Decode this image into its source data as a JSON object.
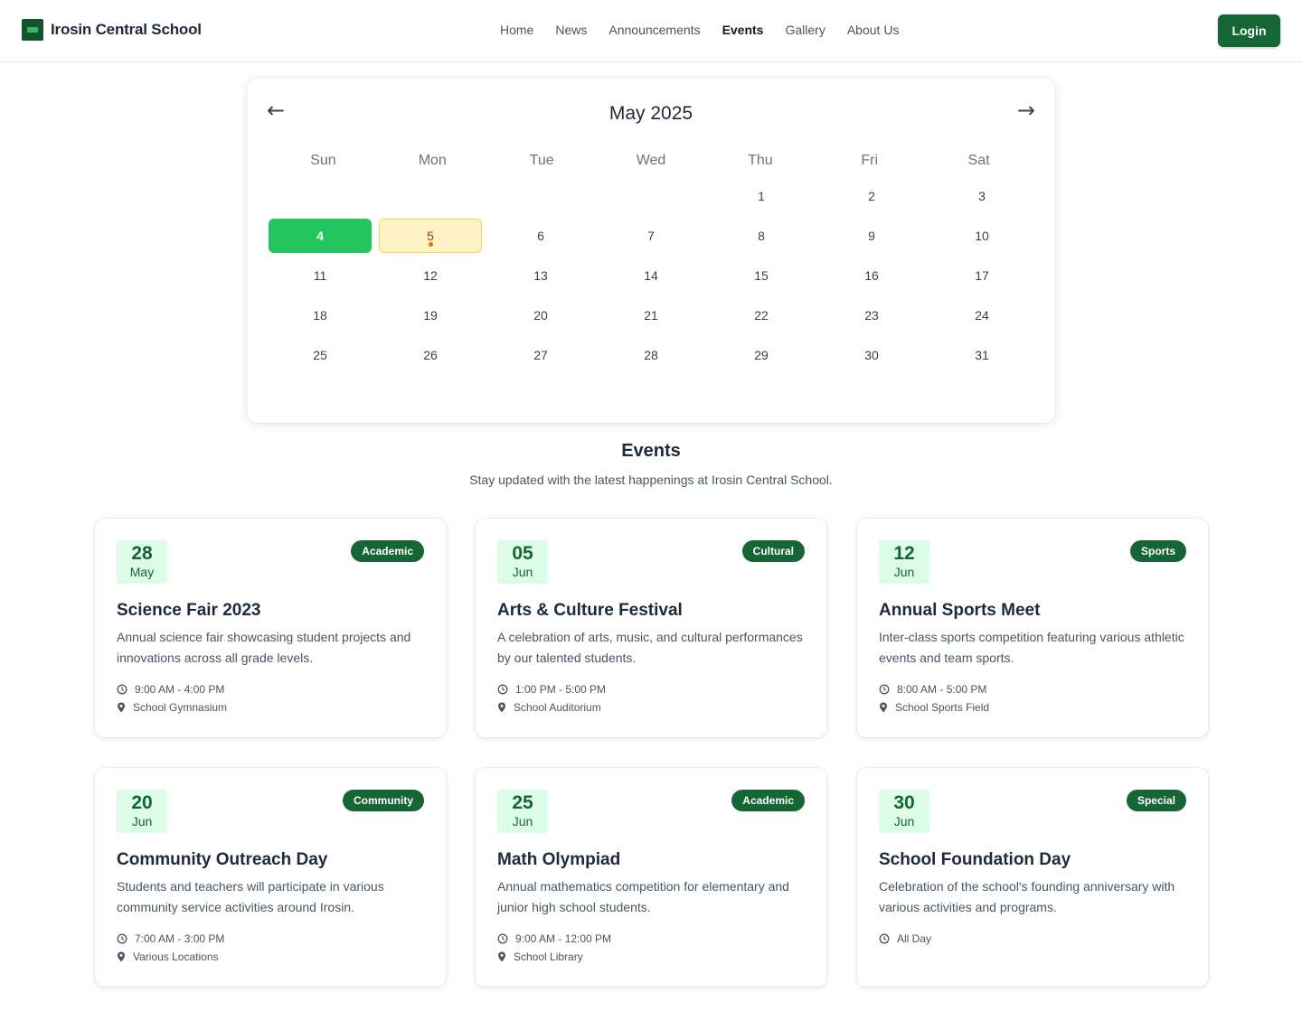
{
  "header": {
    "brand": "Irosin Central School",
    "nav": [
      "Home",
      "News",
      "Announcements",
      "Events",
      "Gallery",
      "About Us"
    ],
    "active_nav": "Events",
    "login_label": "Login"
  },
  "calendar": {
    "month_label": "May 2025",
    "prev_icon": "←",
    "next_icon": "→",
    "weekdays": [
      "Sun",
      "Mon",
      "Tue",
      "Wed",
      "Thu",
      "Fri",
      "Sat"
    ],
    "leading_blanks": 4,
    "days_in_month": 31,
    "today": 4,
    "event_days": [
      5
    ]
  },
  "events_section": {
    "title": "Events",
    "subtitle": "Stay updated with the latest happenings at Irosin Central School."
  },
  "events": [
    {
      "day": "28",
      "month": "May",
      "category": "Academic",
      "title": "Science Fair 2023",
      "description": "Annual science fair showcasing student projects and innovations across all grade levels.",
      "time": "9:00 AM - 4:00 PM",
      "location": "School Gymnasium"
    },
    {
      "day": "05",
      "month": "Jun",
      "category": "Cultural",
      "title": "Arts & Culture Festival",
      "description": "A celebration of arts, music, and cultural performances by our talented students.",
      "time": "1:00 PM - 5:00 PM",
      "location": "School Auditorium"
    },
    {
      "day": "12",
      "month": "Jun",
      "category": "Sports",
      "title": "Annual Sports Meet",
      "description": "Inter-class sports competition featuring various athletic events and team sports.",
      "time": "8:00 AM - 5:00 PM",
      "location": "School Sports Field"
    },
    {
      "day": "20",
      "month": "Jun",
      "category": "Community",
      "title": "Community Outreach Day",
      "description": "Students and teachers will participate in various community service activities around Irosin.",
      "time": "7:00 AM - 3:00 PM",
      "location": "Various Locations"
    },
    {
      "day": "25",
      "month": "Jun",
      "category": "Academic",
      "title": "Math Olympiad",
      "description": "Annual mathematics competition for elementary and junior high school students.",
      "time": "9:00 AM - 12:00 PM",
      "location": "School Library"
    },
    {
      "day": "30",
      "month": "Jun",
      "category": "Special",
      "title": "School Foundation Day",
      "description": "Celebration of the school's founding anniversary with various activities and programs.",
      "time": "All Day",
      "location": null
    }
  ],
  "icons": {
    "time": "clock-icon",
    "location": "map-pin-icon",
    "logo": "school-logo-icon"
  },
  "colors": {
    "primary": "#166534",
    "today": "#22c55e",
    "event_day": "#fef3c7",
    "badge_text": "#ffffff"
  }
}
